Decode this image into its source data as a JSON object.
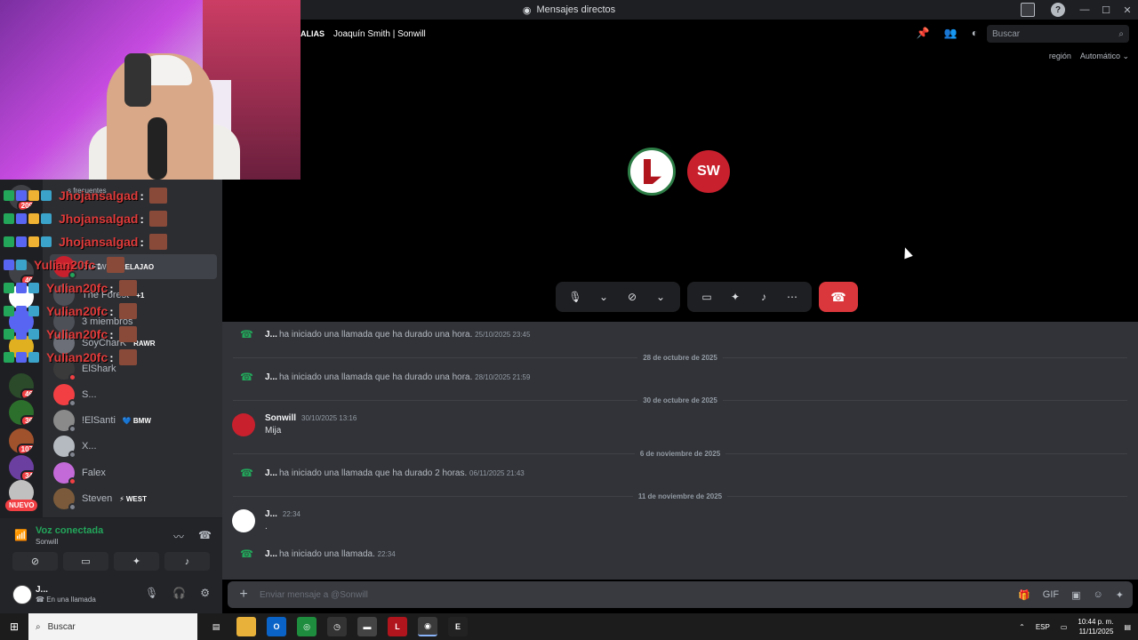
{
  "window": {
    "title": "Mensajes directos",
    "controls": [
      "—",
      "☐",
      "✕"
    ]
  },
  "header": {
    "alias": "ALIAS",
    "conversation": "Joaquín Smith | Sonwill",
    "search_placeholder": "Buscar",
    "region_label": "región",
    "region_value": "Automático"
  },
  "chat_overlay": {
    "lines": [
      {
        "name": "Jhojansalgad",
        "colon": ":"
      },
      {
        "name": "Jhojansalgad",
        "colon": ":"
      },
      {
        "name": "Jhojansalgad",
        "colon": ":"
      },
      {
        "name": "Yulian20fc",
        "colon": ":"
      },
      {
        "name": "Yulian20fc",
        "colon": ":"
      },
      {
        "name": "Yulian20fc",
        "colon": ":"
      },
      {
        "name": "Yulian20fc",
        "colon": ":"
      },
      {
        "name": "Yulian20fc",
        "colon": ":"
      }
    ],
    "header_fragment": "s frecuentes"
  },
  "dm_list": {
    "items": [
      {
        "name": "Sonwill",
        "tag": "RELAJAO",
        "selected": true
      },
      {
        "name": "The Forest",
        "tag": "+1"
      },
      {
        "name": "3 miembros",
        "tag": ""
      },
      {
        "name": "SoyCharK",
        "tag": "RAWR"
      },
      {
        "name": "ElShark",
        "tag": ""
      },
      {
        "name": "S...",
        "tag": ""
      },
      {
        "name": "!ElSanti",
        "tag": "BMW"
      },
      {
        "name": "X...",
        "tag": ""
      },
      {
        "name": "Falex",
        "tag": ""
      },
      {
        "name": "Steven",
        "tag": "WEST"
      }
    ]
  },
  "servers": {
    "badges": [
      "209",
      "40",
      "46",
      "36",
      "107",
      "34"
    ],
    "nuevo": "NUEVO"
  },
  "voice": {
    "title": "Voz conectada",
    "subtitle": "Sonwill"
  },
  "user": {
    "name": "J...",
    "status": "En una llamada"
  },
  "call": {
    "user_b_initials": "SW"
  },
  "messages": {
    "items": [
      {
        "kind": "sys",
        "who": "J...",
        "text": "ha iniciado una llamada que ha durado una hora.",
        "time": "25/10/2025 23:45"
      },
      {
        "kind": "divider",
        "text": "28 de octubre de 2025"
      },
      {
        "kind": "sys",
        "who": "J...",
        "text": "ha iniciado una llamada que ha durado una hora.",
        "time": "28/10/2025 21:59"
      },
      {
        "kind": "divider",
        "text": "30 de octubre de 2025"
      },
      {
        "kind": "msg",
        "author": "Sonwill",
        "time": "30/10/2025 13:16",
        "body": "Mija"
      },
      {
        "kind": "divider",
        "text": "6 de noviembre de 2025"
      },
      {
        "kind": "sys",
        "who": "J...",
        "text": "ha iniciado una llamada que ha durado 2 horas.",
        "time": "06/11/2025 21:43"
      },
      {
        "kind": "divider",
        "text": "11 de noviembre de 2025"
      },
      {
        "kind": "msg",
        "author": "J...",
        "time": "22:34",
        "body": "."
      },
      {
        "kind": "sys",
        "who": "J...",
        "text": "ha iniciado una llamada.",
        "time": "22:34"
      }
    ]
  },
  "composer": {
    "placeholder": "Enviar mensaje a @Sonwill"
  },
  "taskbar": {
    "search": "Buscar",
    "lang": "ESP",
    "time": "10:44 p. m.",
    "date": "11/11/2025"
  },
  "colors": {
    "accent_green": "#23a55a",
    "hangup_red": "#da373c",
    "chat_name_red": "#e03a3a"
  }
}
